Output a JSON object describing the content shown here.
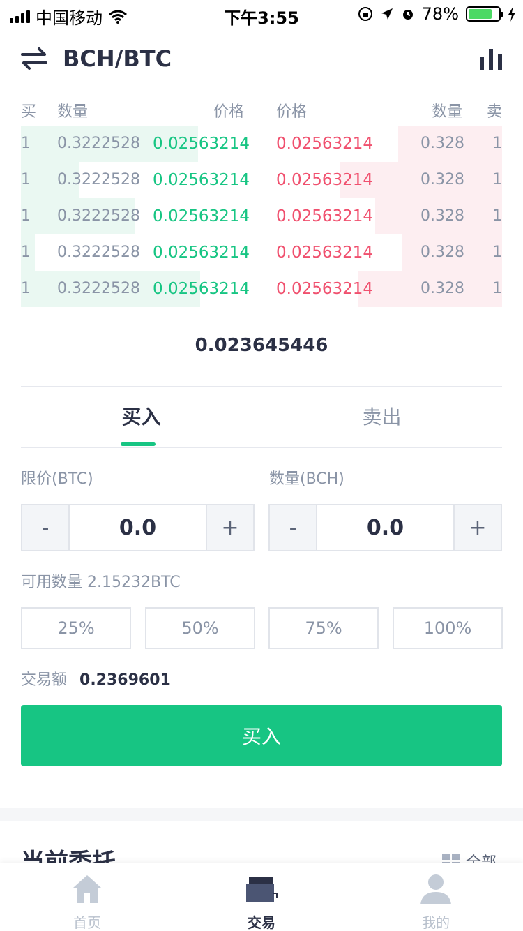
{
  "status_bar": {
    "carrier": "中国移动",
    "time": "下午3:55",
    "battery": "78%"
  },
  "header": {
    "pair": "BCH/BTC"
  },
  "order_book": {
    "headers": {
      "buy": "买",
      "buy_qty": "数量",
      "buy_price": "价格",
      "sell_price": "价格",
      "sell_qty": "数量",
      "sell": "卖"
    },
    "rows": [
      {
        "buy_n": "1",
        "buy_qty": "0.3222528",
        "buy_price": "0.02563214",
        "sell_price": "0.02563214",
        "sell_qty": "0.328",
        "sell_n": "1"
      },
      {
        "buy_n": "1",
        "buy_qty": "0.3222528",
        "buy_price": "0.02563214",
        "sell_price": "0.02563214",
        "sell_qty": "0.328",
        "sell_n": "1"
      },
      {
        "buy_n": "1",
        "buy_qty": "0.3222528",
        "buy_price": "0.02563214",
        "sell_price": "0.02563214",
        "sell_qty": "0.328",
        "sell_n": "1"
      },
      {
        "buy_n": "1",
        "buy_qty": "0.3222528",
        "buy_price": "0.02563214",
        "sell_price": "0.02563214",
        "sell_qty": "0.328",
        "sell_n": "1"
      },
      {
        "buy_n": "1",
        "buy_qty": "0.3222528",
        "buy_price": "0.02563214",
        "sell_price": "0.02563214",
        "sell_qty": "0.328",
        "sell_n": "1"
      }
    ],
    "buy_depth_fraction": [
      0.368,
      0.12,
      0.236,
      0.029,
      0.372
    ],
    "sell_depth_fraction": [
      0.216,
      0.338,
      0.264,
      0.207,
      0.3
    ],
    "last_price": "0.023645446"
  },
  "tabs": {
    "buy": "买入",
    "sell": "卖出"
  },
  "form": {
    "price_label": "限价(BTC)",
    "qty_label": "数量(BCH)",
    "price_value": "0.0",
    "qty_value": "0.0",
    "minus": "-",
    "plus": "+",
    "available": "可用数量 2.15232BTC",
    "percents": [
      "25%",
      "50%",
      "75%",
      "100%"
    ],
    "amount_label": "交易额",
    "amount_value": "0.2369601",
    "submit": "买入"
  },
  "orders": {
    "title": "当前委托",
    "all": "全部"
  },
  "tabbar": {
    "home": "首页",
    "trade": "交易",
    "mine": "我的"
  },
  "colors": {
    "buy": "#17c583",
    "sell": "#f0506e",
    "buy_bg": "#eaf8f2",
    "sell_bg": "#fdeef1"
  }
}
